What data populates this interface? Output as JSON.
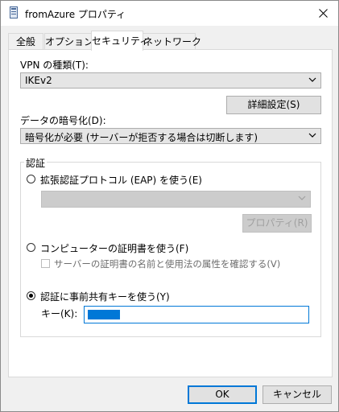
{
  "window": {
    "title": "fromAzure プロパティ"
  },
  "tabs": [
    {
      "label": "全般",
      "active": false
    },
    {
      "label": "オプション",
      "active": false
    },
    {
      "label": "セキュリティ",
      "active": true
    },
    {
      "label": "ネットワーク",
      "active": false
    }
  ],
  "vpn_type": {
    "label": "VPN の種類(T):",
    "value": "IKEv2"
  },
  "advanced_settings_button": "詳細設定(S)",
  "encryption": {
    "label": "データの暗号化(D):",
    "value": "暗号化が必要 (サーバーが拒否する場合は切断します)"
  },
  "auth": {
    "group_title": "認証",
    "eap": {
      "label": "拡張認証プロトコル (EAP) を使う(E)",
      "selected": false,
      "combo_value": "",
      "properties_button": "プロパティ(R)"
    },
    "cert": {
      "label": "コンピューターの証明書を使う(F)",
      "selected": false,
      "check_label": "サーバーの証明書の名前と使用法の属性を確認する(V)"
    },
    "psk": {
      "label": "認証に事前共有キーを使う(Y)",
      "selected": true,
      "key_label": "キー(K):",
      "key_value": ""
    }
  },
  "footer": {
    "ok": "OK",
    "cancel": "キャンセル"
  },
  "colors": {
    "accent": "#0078d7"
  }
}
